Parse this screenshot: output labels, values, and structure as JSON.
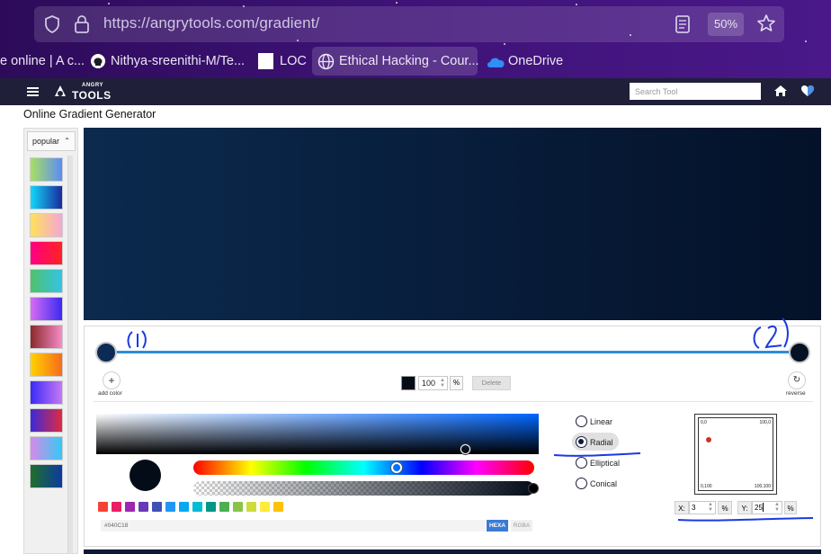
{
  "browser": {
    "url": "https://angrytools.com/gradient/",
    "zoom": "50%",
    "bookmarks": [
      {
        "label": "e online | A c..."
      },
      {
        "label": "Nithya-sreenithi-M/Te..."
      },
      {
        "label": "LOC"
      },
      {
        "label": "Ethical Hacking - Cour..."
      },
      {
        "label": "OneDrive"
      }
    ]
  },
  "site": {
    "logo_top": "ANGRY",
    "logo_main": "TOOLS",
    "search_placeholder": "Search Tool"
  },
  "page": {
    "title": "Online Gradient Generator"
  },
  "sidebar": {
    "filter_label": "popular",
    "presets": [
      [
        "#a8e063",
        "#5b8cf5"
      ],
      [
        "#12d8fa",
        "#1a2a9c"
      ],
      [
        "#ffe259",
        "#f4a6d7"
      ],
      [
        "#ff0084",
        "#ff2222"
      ],
      [
        "#4ec26a",
        "#34c3e8"
      ],
      [
        "#d86cf5",
        "#3a2bf0"
      ],
      [
        "#8a2a2a",
        "#f58cc8"
      ],
      [
        "#ffd200",
        "#f76b1c"
      ],
      [
        "#3b2bf5",
        "#c777f5"
      ],
      [
        "#3c2ad8",
        "#e02a40"
      ],
      [
        "#d88ae8",
        "#33c9f5"
      ],
      [
        "#1f6f2a",
        "#0c3aa0"
      ]
    ]
  },
  "editor": {
    "stops": [
      {
        "color": "#0b2b55",
        "position": 0
      },
      {
        "color": "#051224",
        "position": 100
      }
    ],
    "add_color_label": "add color",
    "reverse_label": "reverse",
    "selected_stop_color": "#040c18",
    "opacity": "100",
    "percent_symbol": "%",
    "delete_label": "Delete",
    "hue_value": 0.6,
    "alpha_value": 1.0,
    "palette": [
      "#f44336",
      "#e91e63",
      "#9c27b0",
      "#673ab7",
      "#3f51b5",
      "#2196f3",
      "#03a9f4",
      "#00bcd4",
      "#009688",
      "#4caf50",
      "#8bc34a",
      "#cddc39",
      "#ffeb3b",
      "#ffc107"
    ],
    "hex_value": "#040C18",
    "hexa_label": "HEXA",
    "rgba_label": "RGBA",
    "types": [
      {
        "label": "Linear",
        "selected": false
      },
      {
        "label": "Radial",
        "selected": true
      },
      {
        "label": "Elliptical",
        "selected": false
      },
      {
        "label": "Conical",
        "selected": false
      }
    ],
    "position_grid": {
      "top_left": "0,0",
      "top_right": "100,0",
      "bottom_left": "0,100",
      "bottom_right": "100,100"
    },
    "x_label": "X:",
    "x_value": "3",
    "y_label": "Y:",
    "y_value": "25",
    "annotations": [
      "(1)",
      "(2)"
    ]
  },
  "colors": {
    "preview_start": "#0b2a4e",
    "preview_end": "#041129",
    "accent": "#2a8fd8"
  }
}
